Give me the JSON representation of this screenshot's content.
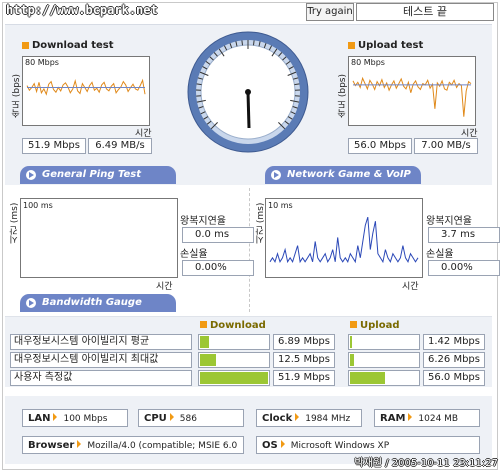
{
  "header": {
    "site": "http://www.bcpark.net",
    "try_again": "Try again",
    "status": "테스트 끝"
  },
  "download": {
    "title": "Download test",
    "ylabel": "속도 (bps)",
    "scale": "80 Mbps",
    "xlabel": "시간",
    "mbps": "51.9 Mbps",
    "mbs": "6.49 MB/s"
  },
  "upload": {
    "title": "Upload test",
    "ylabel": "속도 (bps)",
    "scale": "80 Mbps",
    "xlabel": "시간",
    "mbps": "56.0 Mbps",
    "mbs": "7.00 MB/s"
  },
  "tabs": {
    "ping": "General Ping Test",
    "game": "Network Game & VoIP Test",
    "bandwidth": "Bandwidth Gauge"
  },
  "ping": {
    "ylabel": "시간 (ms)",
    "scale": "100 ms",
    "xlabel": "시간",
    "rtt_label": "왕복지연율",
    "rtt": "0.0 ms",
    "loss_label": "손실율",
    "loss": "0.00%"
  },
  "game": {
    "ylabel": "시간 (ms)",
    "scale": "10 ms",
    "xlabel": "시간",
    "rtt_label": "왕복지연율",
    "rtt": "3.7 ms",
    "loss_label": "손실율",
    "loss": "0.00%"
  },
  "bandwidth": {
    "download_header": "Download",
    "upload_header": "Upload",
    "rows": [
      {
        "label": "대우정보시스템 아이빌리지 평균",
        "dl": "6.89 Mbps",
        "dl_frac": 0.13,
        "ul": "1.42 Mbps",
        "ul_frac": 0.03
      },
      {
        "label": "대우정보시스템 아이빌리지 최대값",
        "dl": "12.5 Mbps",
        "dl_frac": 0.24,
        "ul": "6.26 Mbps",
        "ul_frac": 0.06
      },
      {
        "label": "사용자 측정값",
        "dl": "51.9 Mbps",
        "dl_frac": 1.0,
        "ul": "56.0 Mbps",
        "ul_frac": 0.52
      }
    ]
  },
  "system": {
    "lan_label": "LAN",
    "lan": "100 Mbps",
    "cpu_label": "CPU",
    "cpu": "586",
    "clock_label": "Clock",
    "clock": "1984 MHz",
    "ram_label": "RAM",
    "ram": "1024 MB",
    "browser_label": "Browser",
    "browser": "Mozilla/4.0 (compatible; MSIE 6.0",
    "os_label": "OS",
    "os": "Microsoft Windows XP"
  },
  "watermark": "박재원 / 2005-10-11 23:11:27",
  "colors": {
    "accent": "#f19a14",
    "tab": "#6e85c7",
    "bar": "#9cc734",
    "panel_bg": "#eef1f6"
  },
  "series": {
    "download": [
      55,
      48,
      52,
      58,
      46,
      60,
      44,
      50,
      42,
      57,
      61,
      49,
      45,
      52,
      47,
      56,
      59,
      53,
      44,
      50,
      62,
      47,
      43,
      58,
      52,
      46,
      55,
      60,
      48,
      51,
      45,
      56,
      60,
      50,
      47,
      54,
      58,
      44,
      49,
      53,
      61,
      56,
      46,
      52,
      57,
      50,
      48,
      55,
      63,
      42
    ],
    "upload": [
      62,
      55,
      60,
      52,
      66,
      58,
      50,
      63,
      57,
      49,
      61,
      55,
      64,
      52,
      59,
      48,
      56,
      62,
      51,
      58,
      65,
      54,
      50,
      60,
      44,
      57,
      62,
      53,
      49,
      58,
      56,
      63,
      51,
      57,
      20,
      59,
      54,
      62,
      50,
      48,
      60,
      56,
      63,
      52,
      58,
      55,
      8,
      47,
      61,
      58
    ],
    "game": [
      3,
      4,
      3,
      5,
      3,
      4,
      6,
      3,
      4,
      3,
      5,
      7,
      3,
      4,
      3,
      4,
      5,
      3,
      8,
      4,
      3,
      4,
      5,
      3,
      4,
      6,
      3,
      9,
      4,
      3,
      4,
      3,
      5,
      4,
      3,
      7,
      4,
      8,
      12,
      14,
      6,
      10,
      13,
      5,
      4,
      3,
      6,
      4,
      3,
      5,
      4,
      3,
      4,
      7,
      4,
      3,
      5,
      4,
      3,
      4
    ]
  }
}
